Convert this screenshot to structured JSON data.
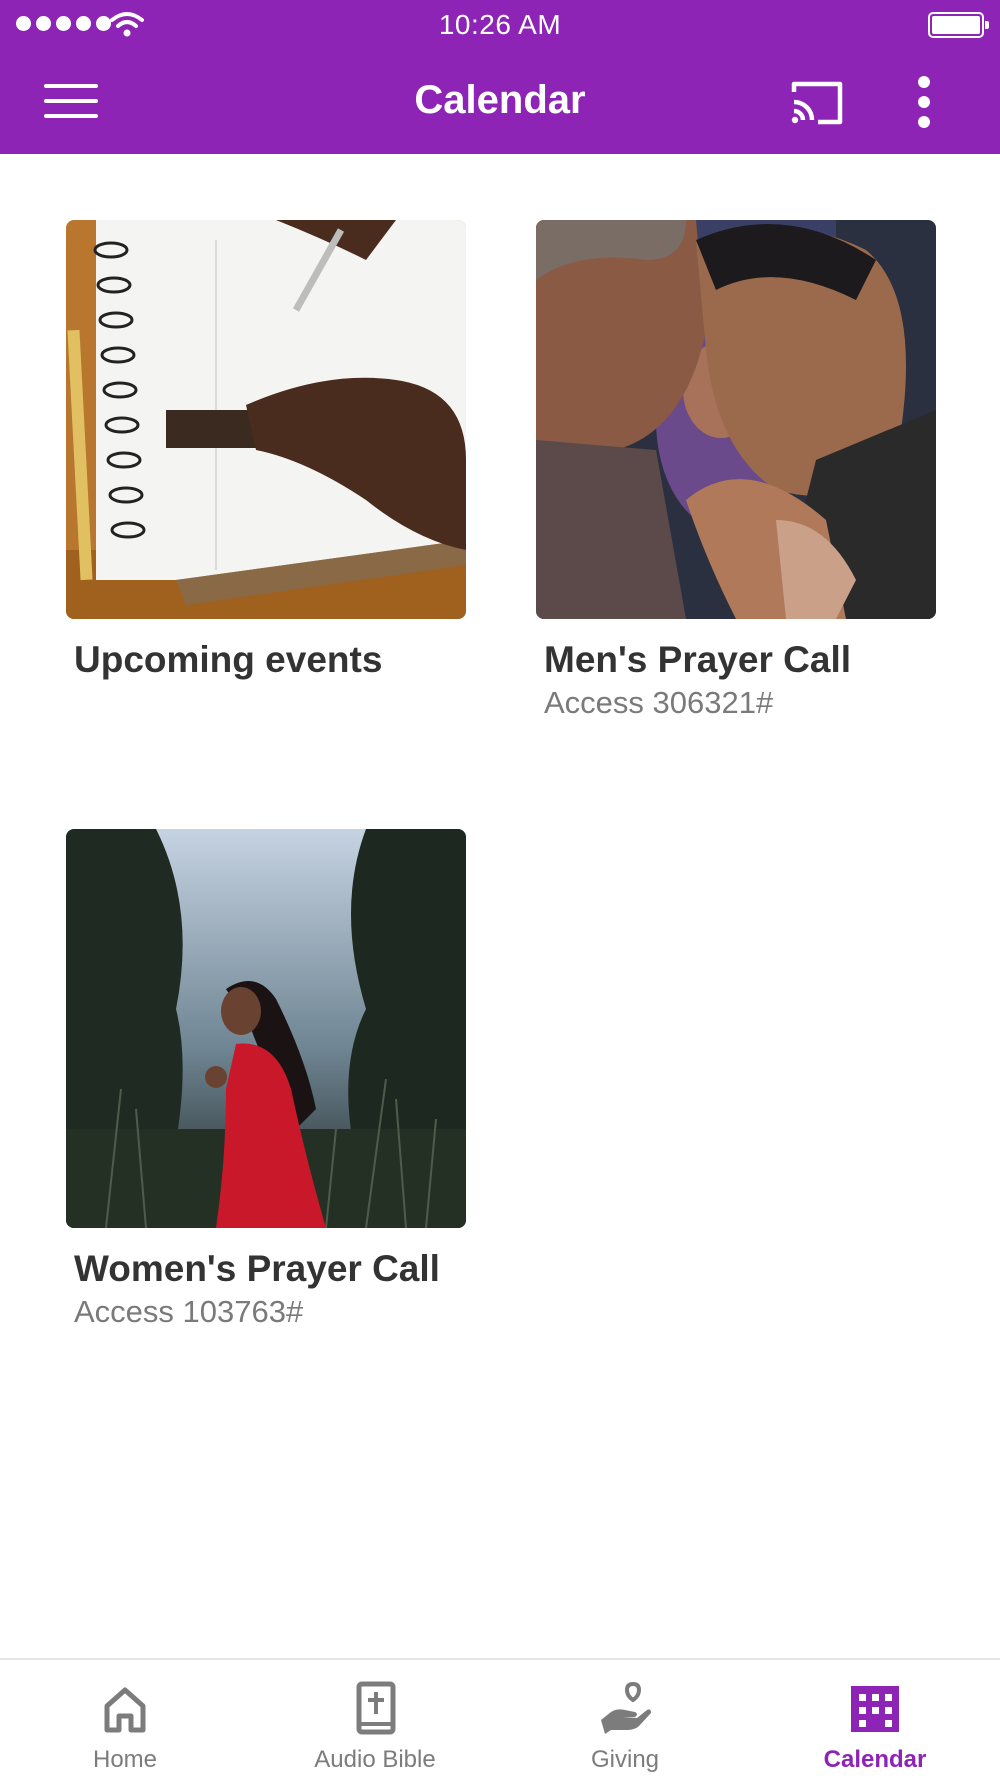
{
  "status_bar": {
    "time": "10:26 AM"
  },
  "header": {
    "title": "Calendar",
    "menu_icon": "hamburger-menu-icon",
    "cast_icon": "cast-icon",
    "more_icon": "more-vertical-icon"
  },
  "colors": {
    "accent": "#8e24b5",
    "title_text": "#333333",
    "subtitle_text": "#7a7a7a",
    "tab_inactive": "#7c7c7c"
  },
  "cards": [
    {
      "title": "Upcoming events",
      "subtitle": ""
    },
    {
      "title": "Men's Prayer Call",
      "subtitle": "Access 306321#"
    },
    {
      "title": "Women's Prayer Call",
      "subtitle": "Access 103763#"
    }
  ],
  "tabs": [
    {
      "label": "Home",
      "icon": "home-icon",
      "active": false
    },
    {
      "label": "Audio Bible",
      "icon": "bible-icon",
      "active": false
    },
    {
      "label": "Giving",
      "icon": "giving-heart-hand-icon",
      "active": false
    },
    {
      "label": "Calendar",
      "icon": "building-calendar-icon",
      "active": true
    }
  ]
}
